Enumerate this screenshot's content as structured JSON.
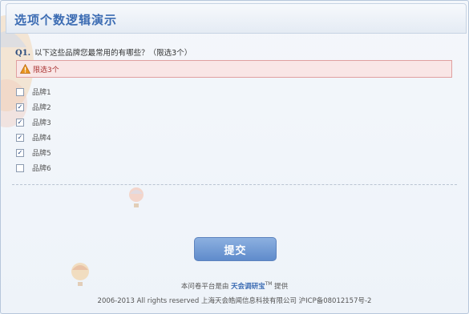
{
  "header": {
    "title": "选项个数逻辑演示"
  },
  "question": {
    "number": "Q1.",
    "text": "以下这些品牌您最常用的有哪些？（限选3个）"
  },
  "warning": {
    "icon": "warning-icon",
    "text": "限选3个"
  },
  "options": [
    {
      "label": "品牌1",
      "checked": false
    },
    {
      "label": "品牌2",
      "checked": true
    },
    {
      "label": "品牌3",
      "checked": true
    },
    {
      "label": "品牌4",
      "checked": true
    },
    {
      "label": "品牌5",
      "checked": true
    },
    {
      "label": "品牌6",
      "checked": false
    }
  ],
  "submit": {
    "label": "提交"
  },
  "footer": {
    "prefix": "本问卷平台是由",
    "brand": "天会调研宝",
    "tm": "TM",
    "suffix": "提供",
    "copyright": "2006-2013 All rights reserved 上海天会皓闻信息科技有限公司 沪ICP备08012157号-2"
  },
  "colors": {
    "accent": "#3c6cb3",
    "warning_bg": "#f9e6e6",
    "warning_border": "#e0a0a0",
    "button": "#6f97d2"
  }
}
